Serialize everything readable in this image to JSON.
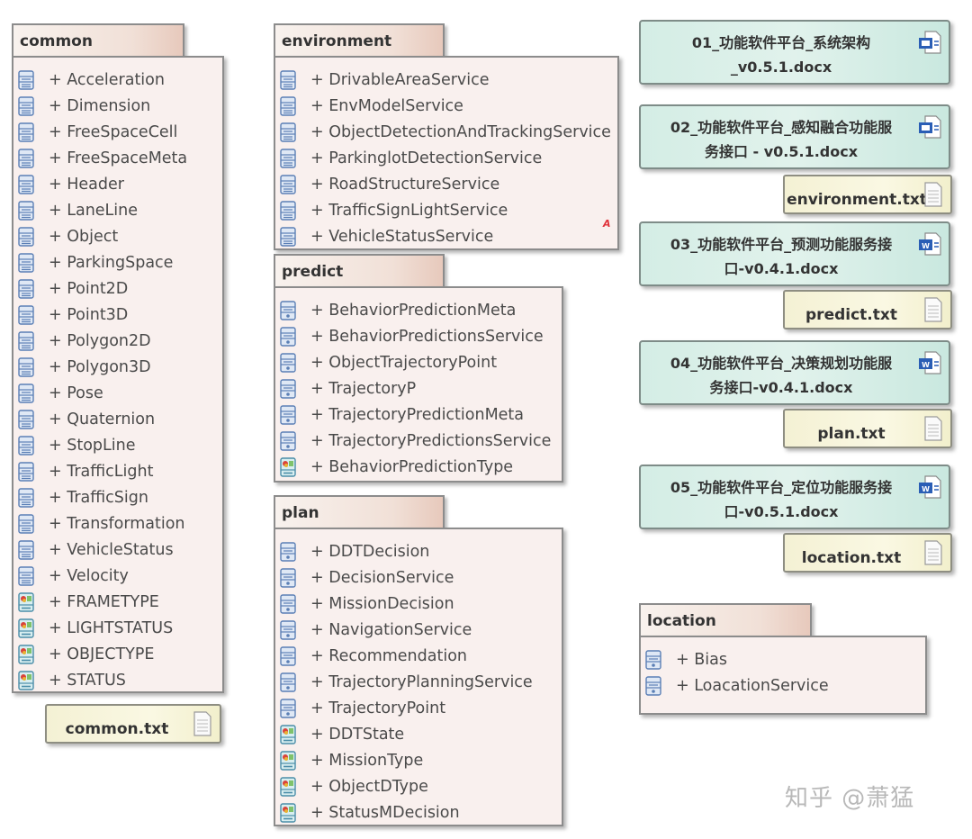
{
  "packages": [
    {
      "id": "common",
      "title": "common",
      "items": [
        {
          "label": "+ Acceleration",
          "icon": "class"
        },
        {
          "label": "+ Dimension",
          "icon": "class"
        },
        {
          "label": "+ FreeSpaceCell",
          "icon": "class"
        },
        {
          "label": "+ FreeSpaceMeta",
          "icon": "class"
        },
        {
          "label": "+ Header",
          "icon": "class"
        },
        {
          "label": "+ LaneLine",
          "icon": "class"
        },
        {
          "label": "+ Object",
          "icon": "class"
        },
        {
          "label": "+ ParkingSpace",
          "icon": "class"
        },
        {
          "label": "+ Point2D",
          "icon": "class"
        },
        {
          "label": "+ Point3D",
          "icon": "class"
        },
        {
          "label": "+ Polygon2D",
          "icon": "class"
        },
        {
          "label": "+ Polygon3D",
          "icon": "class"
        },
        {
          "label": "+ Pose",
          "icon": "class"
        },
        {
          "label": "+ Quaternion",
          "icon": "class"
        },
        {
          "label": "+ StopLine",
          "icon": "class"
        },
        {
          "label": "+ TrafficLight",
          "icon": "class"
        },
        {
          "label": "+ TrafficSign",
          "icon": "class"
        },
        {
          "label": "+ Transformation",
          "icon": "class"
        },
        {
          "label": "+ VehicleStatus",
          "icon": "class"
        },
        {
          "label": "+ Velocity",
          "icon": "class"
        },
        {
          "label": "+ FRAMETYPE",
          "icon": "enum"
        },
        {
          "label": "+ LIGHTSTATUS",
          "icon": "enum"
        },
        {
          "label": "+ OBJECTYPE",
          "icon": "enum"
        },
        {
          "label": "+ STATUS",
          "icon": "enum"
        }
      ]
    },
    {
      "id": "environment",
      "title": "environment",
      "items": [
        {
          "label": "+ DrivableAreaService",
          "icon": "class"
        },
        {
          "label": "+ EnvModelService",
          "icon": "class"
        },
        {
          "label": "+ ObjectDetectionAndTrackingService",
          "icon": "class"
        },
        {
          "label": "+ ParkinglotDetectionService",
          "icon": "class"
        },
        {
          "label": "+ RoadStructureService",
          "icon": "class"
        },
        {
          "label": "+ TrafficSignLightService",
          "icon": "class"
        },
        {
          "label": "+ VehicleStatusService",
          "icon": "class"
        }
      ],
      "marker": "A"
    },
    {
      "id": "predict",
      "title": "predict",
      "items": [
        {
          "label": "+ BehaviorPredictionMeta",
          "icon": "class2"
        },
        {
          "label": "+ BehaviorPredictionsService",
          "icon": "class2"
        },
        {
          "label": "+ ObjectTrajectoryPoint",
          "icon": "class2"
        },
        {
          "label": "+ TrajectoryP",
          "icon": "class2"
        },
        {
          "label": "+ TrajectoryPredictionMeta",
          "icon": "class2"
        },
        {
          "label": "+ TrajectoryPredictionsService",
          "icon": "class2"
        },
        {
          "label": "+ BehaviorPredictionType",
          "icon": "enum"
        }
      ]
    },
    {
      "id": "plan",
      "title": "plan",
      "items": [
        {
          "label": "+ DDTDecision",
          "icon": "class2"
        },
        {
          "label": "+ DecisionService",
          "icon": "class2"
        },
        {
          "label": "+ MissionDecision",
          "icon": "class2"
        },
        {
          "label": "+ NavigationService",
          "icon": "class2"
        },
        {
          "label": "+ Recommendation",
          "icon": "class2"
        },
        {
          "label": "+ TrajectoryPlanningService",
          "icon": "class2"
        },
        {
          "label": "+ TrajectoryPoint",
          "icon": "class2"
        },
        {
          "label": "+ DDTState",
          "icon": "enum"
        },
        {
          "label": "+ MissionType",
          "icon": "enum"
        },
        {
          "label": "+ ObjectDType",
          "icon": "enum"
        },
        {
          "label": "+ StatusMDecision",
          "icon": "enum"
        }
      ]
    },
    {
      "id": "location",
      "title": "location",
      "items": [
        {
          "label": "+ Bias",
          "icon": "class2"
        },
        {
          "label": "+ LoacationService",
          "icon": "class2"
        }
      ]
    }
  ],
  "documents": [
    {
      "line1": "01_功能软件平台_系统架构",
      "line2": "_v0.5.1.docx",
      "icon": "word-doc-icon"
    },
    {
      "line1": "02_功能软件平台_感知融合功能服",
      "line2": "务接口 - v0.5.1.docx",
      "icon": "word-doc-icon"
    },
    {
      "line1": "03_功能软件平台_预测功能服务接",
      "line2": "口-v0.4.1.docx",
      "icon": "word-doc-icon"
    },
    {
      "line1": "04_功能软件平台_决策规划功能服",
      "line2": "务接口-v0.4.1.docx",
      "icon": "word-doc-icon"
    },
    {
      "line1": "05_功能软件平台_定位功能服务接",
      "line2": "口-v0.5.1.docx",
      "icon": "word-doc-icon"
    }
  ],
  "text_files": [
    {
      "label": "common.txt"
    },
    {
      "label": "environment.txt"
    },
    {
      "label": "predict.txt"
    },
    {
      "label": "plan.txt"
    },
    {
      "label": "location.txt"
    }
  ],
  "watermark": "知乎 @萧猛",
  "colors": {
    "package_tab": "#f1e0d7",
    "package_body": "#f9f0ee",
    "doc_bg": "#d4ede5",
    "txt_bg": "#f4f1d4",
    "class_icon": "#5b7fb5",
    "marker": "#e0323a"
  }
}
